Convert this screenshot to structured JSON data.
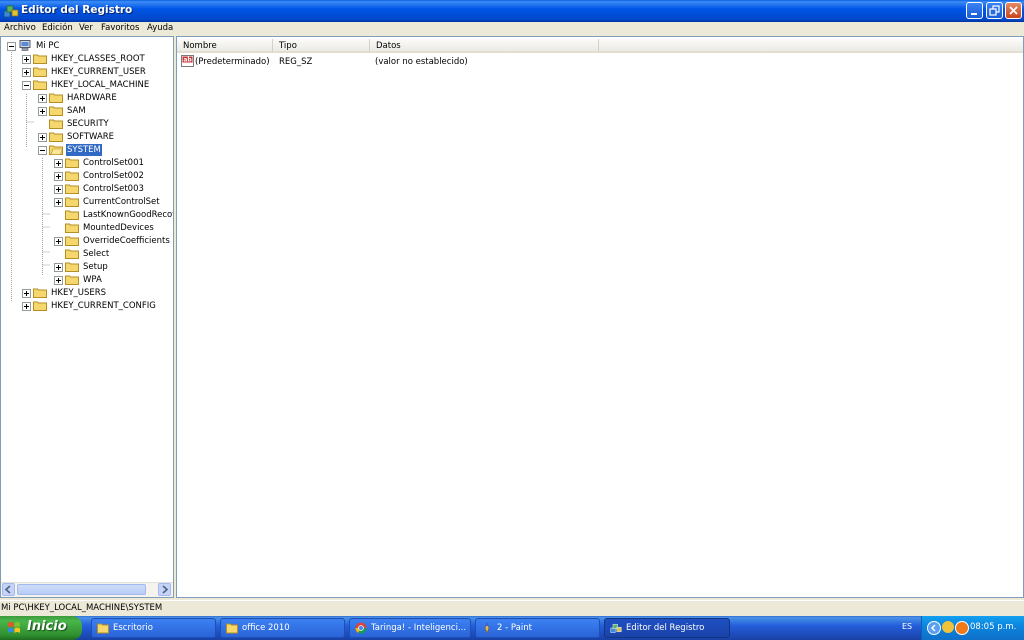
{
  "window": {
    "title": "Editor del Registro",
    "icon": "regedit-icon",
    "buttons": [
      "minimize",
      "restore",
      "close"
    ]
  },
  "menu": [
    "Archivo",
    "Edición",
    "Ver",
    "Favoritos",
    "Ayuda"
  ],
  "tree": {
    "root": "Mi PC",
    "nodes": [
      {
        "label": "Mi PC",
        "expander": "minus"
      },
      {
        "label": "HKEY_CLASSES_ROOT",
        "expander": "plus"
      },
      {
        "label": "HKEY_CURRENT_USER",
        "expander": "plus"
      },
      {
        "label": "HKEY_LOCAL_MACHINE",
        "expander": "minus"
      },
      {
        "label": "HARDWARE",
        "expander": "plus"
      },
      {
        "label": "SAM",
        "expander": "plus"
      },
      {
        "label": "SECURITY",
        "expander": "none"
      },
      {
        "label": "SOFTWARE",
        "expander": "plus"
      },
      {
        "label": "SYSTEM",
        "expander": "minus",
        "selected": true
      },
      {
        "label": "ControlSet001",
        "expander": "plus"
      },
      {
        "label": "ControlSet002",
        "expander": "plus"
      },
      {
        "label": "ControlSet003",
        "expander": "plus"
      },
      {
        "label": "CurrentControlSet",
        "expander": "plus"
      },
      {
        "label": "LastKnownGoodRecove",
        "expander": "none"
      },
      {
        "label": "MountedDevices",
        "expander": "none"
      },
      {
        "label": "OverrideCoefficients",
        "expander": "plus"
      },
      {
        "label": "Select",
        "expander": "none"
      },
      {
        "label": "Setup",
        "expander": "plus"
      },
      {
        "label": "WPA",
        "expander": "plus"
      },
      {
        "label": "HKEY_USERS",
        "expander": "plus"
      },
      {
        "label": "HKEY_CURRENT_CONFIG",
        "expander": "plus"
      }
    ]
  },
  "list": {
    "columns": [
      "Nombre",
      "Tipo",
      "Datos"
    ],
    "rows": [
      {
        "icon": "string-value-icon",
        "name": "(Predeterminado)",
        "type": "REG_SZ",
        "data": "(valor no establecido)"
      }
    ]
  },
  "status": "Mi PC\\HKEY_LOCAL_MACHINE\\SYSTEM",
  "taskbar": {
    "start": "Inicio",
    "tasks": [
      {
        "label": "Escritorio",
        "icon": "folder-icon"
      },
      {
        "label": "office 2010",
        "icon": "folder-icon"
      },
      {
        "label": "Taringa! - Inteligenci...",
        "icon": "chrome-icon"
      },
      {
        "label": "2 - Paint",
        "icon": "paint-icon"
      },
      {
        "label": "Editor del Registro",
        "icon": "regedit-icon",
        "active": true
      }
    ],
    "language": "ES",
    "clock": "08:05 p.m."
  },
  "colors": {
    "selection": "#316AC5",
    "titlebar": "#0055E5",
    "taskbar": "#245EDB",
    "start": "#3C9A3C",
    "folder": "#F5D76E"
  }
}
